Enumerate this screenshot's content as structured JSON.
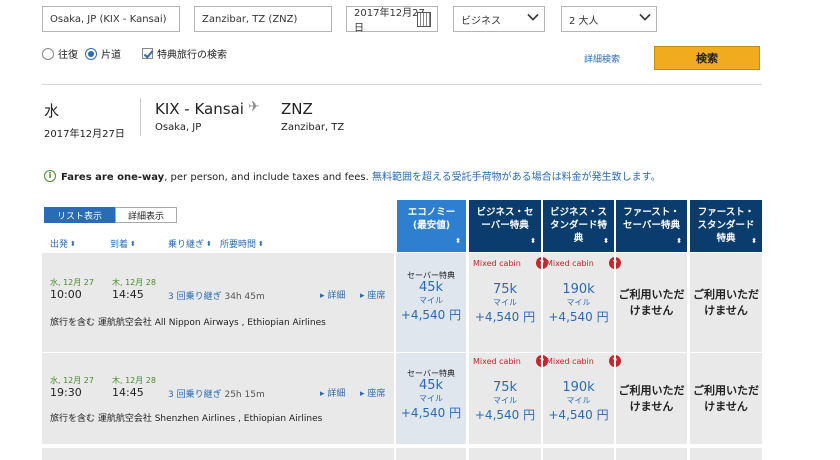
{
  "search": {
    "origin": "Osaka, JP (KIX - Kansai)",
    "destination": "Zanzibar, TZ (ZNZ)",
    "date": "2017年12月27日",
    "cabin": "ビジネス",
    "passengers": "2 大人",
    "trip_round": "往復",
    "trip_oneway": "片道",
    "award_label": "特典旅行の検索",
    "advanced_link": "詳細検索",
    "search_button": "検索"
  },
  "summary": {
    "weekday": "水",
    "date": "2017年12月27日",
    "origin_code": "KIX - Kansai",
    "origin_city": "Osaka, JP",
    "dest_code": "ZNZ",
    "dest_city": "Zanzibar, TZ"
  },
  "notice": {
    "bold": "Fares are one-way",
    "rest": ", per person, and include taxes and fees.",
    "link": "無料範囲を超える受託手荷物がある場合は料金が発生致します。"
  },
  "view_tabs": [
    "リスト表示",
    "詳細表示"
  ],
  "columns": {
    "depart": "出発",
    "arrive": "到着",
    "connections": "乗り継ぎ",
    "duration": "所要時間"
  },
  "fare_headers": [
    [
      "エコノミー",
      "(最安値)"
    ],
    [
      "ビジネス・セ",
      "ーバー特典"
    ],
    [
      "ビジネス・ス",
      "タンダード特",
      "典"
    ],
    [
      "ファースト・",
      "セーバー特典"
    ],
    [
      "ファースト・",
      "スタンダード",
      "特典"
    ]
  ],
  "mixed_cabin_label": "Mixed cabin",
  "detail_link": "詳細",
  "seats_link": "座席",
  "flights": [
    {
      "dep_date": "水, 12月 27",
      "dep_time": "10:00",
      "arr_date": "木, 12月 28",
      "arr_time": "14:45",
      "stops": "3 回乗り継ぎ",
      "duration": "34h 45m",
      "operators": "旅行を含む 運航航空会社 All Nippon Airways , Ethiopian Airlines",
      "eco": {
        "tag": "セーバー特典",
        "points": "45k",
        "unit": "マイル",
        "tax": "+4,540 円"
      },
      "bsaver": {
        "points": "75k",
        "unit": "マイル",
        "tax": "+4,540 円"
      },
      "bstd": {
        "points": "190k",
        "unit": "マイル",
        "tax": "+4,540 円"
      },
      "fsaver": [
        "ご利用いただ",
        "けません"
      ],
      "fstd": [
        "ご利用いただ",
        "けません"
      ]
    },
    {
      "dep_date": "水, 12月 27",
      "dep_time": "19:30",
      "arr_date": "木, 12月 28",
      "arr_time": "14:45",
      "stops": "3 回乗り継ぎ",
      "duration": "25h 15m",
      "operators": "旅行を含む 運航航空会社 Shenzhen Airlines , Ethiopian Airlines",
      "eco": {
        "tag": "セーバー特典",
        "points": "45k",
        "unit": "マイル",
        "tax": "+4,540 円"
      },
      "bsaver": {
        "points": "75k",
        "unit": "マイル",
        "tax": "+4,540 円"
      },
      "bstd": {
        "points": "190k",
        "unit": "マイル",
        "tax": "+4,540 円"
      },
      "fsaver": [
        "ご利用いただ",
        "けません"
      ],
      "fstd": [
        "ご利用いただ",
        "けません"
      ]
    }
  ]
}
